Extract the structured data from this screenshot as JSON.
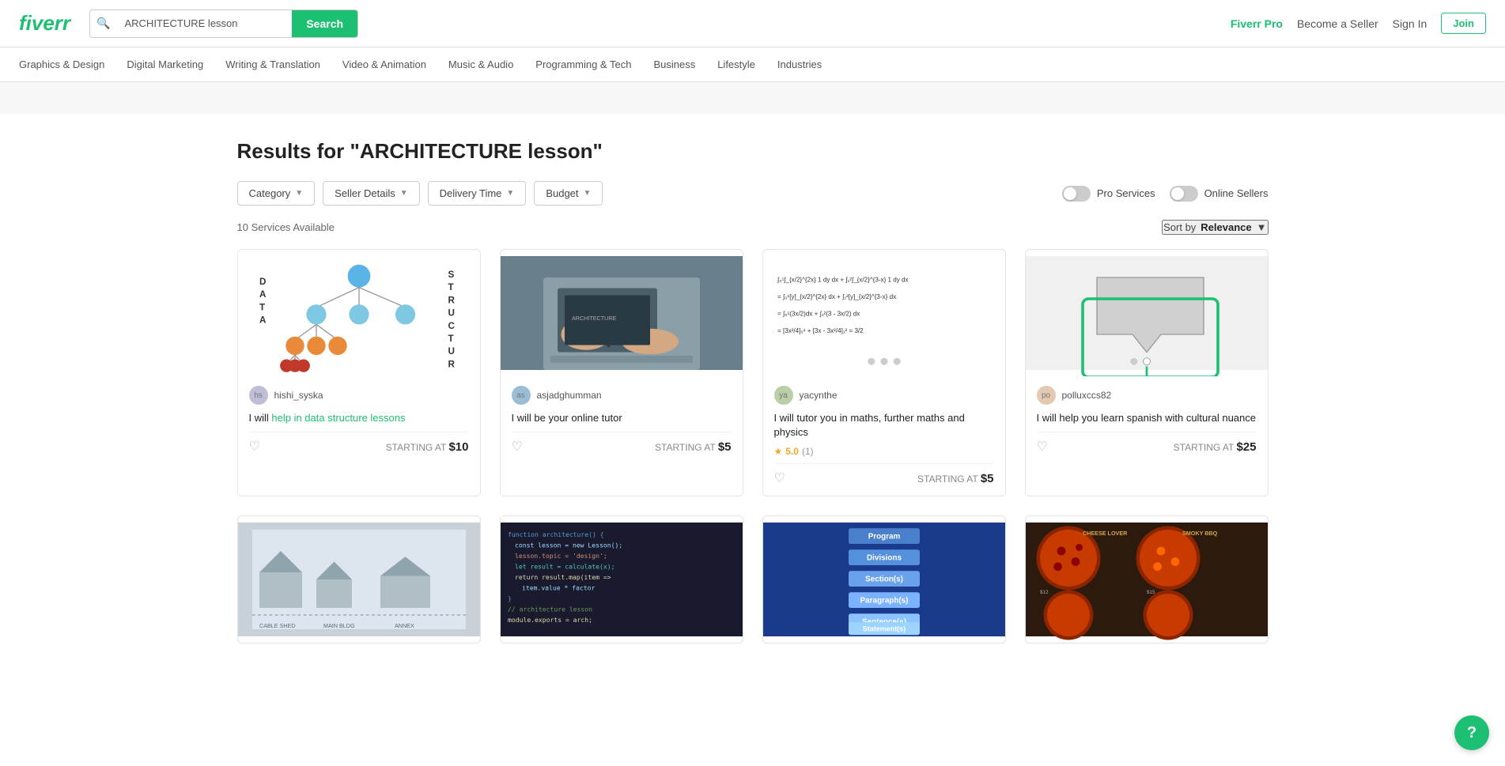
{
  "header": {
    "logo": "fiverr",
    "search": {
      "placeholder": "ARCHITECTURE lesson",
      "value": "ARCHITECTURE lesson",
      "button_label": "Search"
    },
    "nav": {
      "fiverr_pro_label": "Fiverr Pro",
      "become_seller_label": "Become a Seller",
      "sign_in_label": "Sign In",
      "join_label": "Join"
    }
  },
  "categories": [
    {
      "id": "graphics",
      "label": "Graphics & Design"
    },
    {
      "id": "digital",
      "label": "Digital Marketing"
    },
    {
      "id": "writing",
      "label": "Writing & Translation"
    },
    {
      "id": "video",
      "label": "Video & Animation"
    },
    {
      "id": "music",
      "label": "Music & Audio"
    },
    {
      "id": "programming",
      "label": "Programming & Tech"
    },
    {
      "id": "business",
      "label": "Business"
    },
    {
      "id": "lifestyle",
      "label": "Lifestyle"
    },
    {
      "id": "industries",
      "label": "Industries"
    }
  ],
  "results": {
    "title": "Results for \"ARCHITECTURE lesson\"",
    "count": "10 Services Available",
    "sort_label": "Sort by",
    "sort_value": "Relevance"
  },
  "filters": [
    {
      "id": "category",
      "label": "Category"
    },
    {
      "id": "seller-details",
      "label": "Seller Details"
    },
    {
      "id": "delivery-time",
      "label": "Delivery Time"
    },
    {
      "id": "budget",
      "label": "Budget"
    }
  ],
  "toggles": [
    {
      "id": "pro-services",
      "label": "Pro Services",
      "active": false
    },
    {
      "id": "online-sellers",
      "label": "Online Sellers",
      "active": false
    }
  ],
  "cards_row1": [
    {
      "id": "card-ds",
      "seller": "hishi_syska",
      "title_html": "I will help in data structure lessons",
      "title_plain": "I will help in data structure lessons",
      "title_highlight": "help in data structure lessons",
      "rating": null,
      "rating_count": null,
      "starting_at": "STARTING AT",
      "price": "$10",
      "img_type": "ds"
    },
    {
      "id": "card-tutor",
      "seller": "asjadghumman",
      "title_plain": "I will be your online tutor",
      "rating": null,
      "rating_count": null,
      "starting_at": "STARTING AT",
      "price": "$5",
      "img_type": "photo-laptop"
    },
    {
      "id": "card-math",
      "seller": "yacynthe",
      "title_plain": "I will tutor you in maths, further maths and physics",
      "rating": "5.0",
      "rating_count": "(1)",
      "starting_at": "STARTING AT",
      "price": "$5",
      "img_type": "math"
    },
    {
      "id": "card-spanish",
      "seller": "polluxccs82",
      "title_plain": "I will help you learn spanish with cultural nuance",
      "rating": null,
      "rating_count": null,
      "starting_at": "STARTING AT",
      "price": "$25",
      "img_type": "spanish"
    }
  ],
  "cards_row2": [
    {
      "id": "card-arch",
      "img_type": "arch",
      "title": ""
    },
    {
      "id": "card-code",
      "img_type": "code",
      "title": ""
    },
    {
      "id": "card-prog",
      "img_type": "prog",
      "title": ""
    },
    {
      "id": "card-pizza",
      "img_type": "pizza",
      "title": ""
    }
  ],
  "help": {
    "icon": "?"
  }
}
